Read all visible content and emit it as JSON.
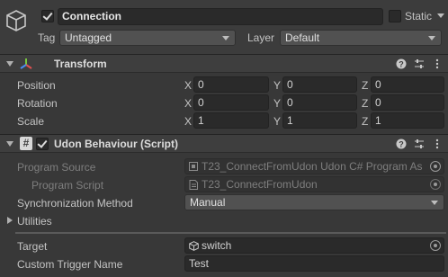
{
  "gameobject": {
    "name": "Connection",
    "static_label": "Static",
    "tag_label": "Tag",
    "tag_value": "Untagged",
    "layer_label": "Layer",
    "layer_value": "Default"
  },
  "transform": {
    "title": "Transform",
    "rows": [
      {
        "label": "Position",
        "x": "0",
        "y": "0",
        "z": "0"
      },
      {
        "label": "Rotation",
        "x": "0",
        "y": "0",
        "z": "0"
      },
      {
        "label": "Scale",
        "x": "1",
        "y": "1",
        "z": "1"
      }
    ],
    "axes": {
      "x": "X",
      "y": "Y",
      "z": "Z"
    }
  },
  "udon": {
    "title": "Udon Behaviour (Script)",
    "program_source_label": "Program Source",
    "program_source_value": "T23_ConnectFromUdon Udon C# Program As",
    "program_script_label": "Program Script",
    "program_script_value": "T23_ConnectFromUdon",
    "sync_label": "Synchronization Method",
    "sync_value": "Manual",
    "utilities_label": "Utilities",
    "target_label": "Target",
    "target_value": "switch",
    "custom_trigger_label": "Custom Trigger Name",
    "custom_trigger_value": "Test"
  },
  "icons": {
    "gameobject": "cube-icon",
    "transform": "transform-axes-icon",
    "script": "hash-script-icon",
    "help": "help-icon",
    "presets": "sliders-icon",
    "menu": "kebab-menu-icon"
  }
}
